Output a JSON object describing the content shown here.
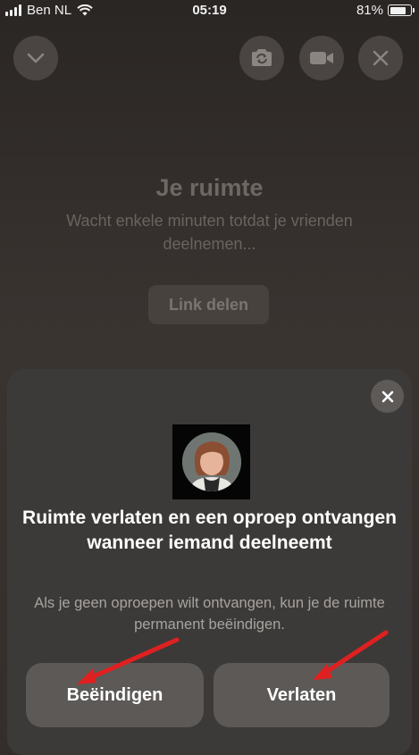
{
  "status_bar": {
    "carrier": "Ben NL",
    "time": "05:19",
    "battery": "81%",
    "battery_level": 0.81,
    "icons": [
      "signal-icon",
      "wifi-icon",
      "battery-icon"
    ]
  },
  "top_controls": {
    "icons": [
      "chevron-down-icon",
      "camera-switch-icon",
      "video-camera-icon",
      "close-icon"
    ]
  },
  "room": {
    "title": "Je ruimte",
    "subtitle": "Wacht enkele minuten totdat je vrienden deelnemen...",
    "link_button": "Link delen"
  },
  "sheet": {
    "title": "Ruimte verlaten en een oproep ontvangen wanneer iemand deelneemt",
    "description": "Als je geen oproepen wilt ontvangen, kun je de ruimte permanent beëindigen.",
    "end_button": "Beëindigen",
    "leave_button": "Verlaten",
    "close_icon": "close-icon",
    "annotation_color": "#e02020"
  }
}
